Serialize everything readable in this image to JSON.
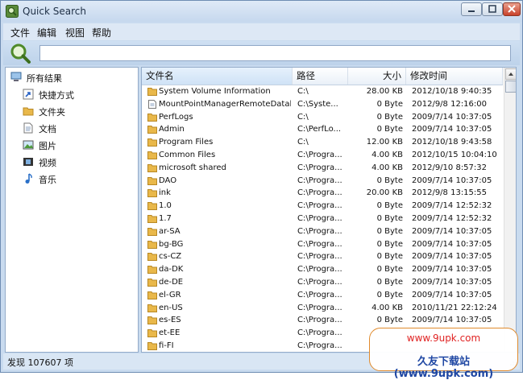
{
  "window": {
    "title": "Quick Search"
  },
  "menu": [
    "文件",
    "编辑",
    "视图",
    "帮助"
  ],
  "search": {
    "value": ""
  },
  "sidebar": {
    "root": {
      "label": "所有结果",
      "icon": "computer-icon"
    },
    "items": [
      {
        "label": "快捷方式",
        "icon": "shortcut-icon"
      },
      {
        "label": "文件夹",
        "icon": "folder-icon"
      },
      {
        "label": "文档",
        "icon": "document-icon"
      },
      {
        "label": "图片",
        "icon": "picture-icon"
      },
      {
        "label": "视频",
        "icon": "video-icon"
      },
      {
        "label": "音乐",
        "icon": "music-icon"
      }
    ]
  },
  "columns": {
    "name": "文件名",
    "path": "路径",
    "size": "大小",
    "date": "修改时间"
  },
  "rows": [
    {
      "icon": "folder",
      "name": "System Volume Information",
      "path": "C:\\",
      "size": "28.00 KB",
      "date": "2012/10/18 9:40:35"
    },
    {
      "icon": "file",
      "name": "MountPointManagerRemoteDatab...",
      "path": "C:\\Syste...",
      "size": "0 Byte",
      "date": "2012/9/8 12:16:00"
    },
    {
      "icon": "folder",
      "name": "PerfLogs",
      "path": "C:\\",
      "size": "0 Byte",
      "date": "2009/7/14 10:37:05"
    },
    {
      "icon": "folder",
      "name": "Admin",
      "path": "C:\\PerfLo...",
      "size": "0 Byte",
      "date": "2009/7/14 10:37:05"
    },
    {
      "icon": "folder",
      "name": "Program Files",
      "path": "C:\\",
      "size": "12.00 KB",
      "date": "2012/10/18 9:43:58"
    },
    {
      "icon": "folder",
      "name": "Common Files",
      "path": "C:\\Progra...",
      "size": "4.00 KB",
      "date": "2012/10/15 10:04:10"
    },
    {
      "icon": "folder",
      "name": "microsoft shared",
      "path": "C:\\Progra...",
      "size": "4.00 KB",
      "date": "2012/9/10 8:57:32"
    },
    {
      "icon": "folder",
      "name": "DAO",
      "path": "C:\\Progra...",
      "size": "0 Byte",
      "date": "2009/7/14 10:37:05"
    },
    {
      "icon": "folder",
      "name": "ink",
      "path": "C:\\Progra...",
      "size": "20.00 KB",
      "date": "2012/9/8 13:15:55"
    },
    {
      "icon": "folder",
      "name": "1.0",
      "path": "C:\\Progra...",
      "size": "0 Byte",
      "date": "2009/7/14 12:52:32"
    },
    {
      "icon": "folder",
      "name": "1.7",
      "path": "C:\\Progra...",
      "size": "0 Byte",
      "date": "2009/7/14 12:52:32"
    },
    {
      "icon": "folder",
      "name": "ar-SA",
      "path": "C:\\Progra...",
      "size": "0 Byte",
      "date": "2009/7/14 10:37:05"
    },
    {
      "icon": "folder",
      "name": "bg-BG",
      "path": "C:\\Progra...",
      "size": "0 Byte",
      "date": "2009/7/14 10:37:05"
    },
    {
      "icon": "folder",
      "name": "cs-CZ",
      "path": "C:\\Progra...",
      "size": "0 Byte",
      "date": "2009/7/14 10:37:05"
    },
    {
      "icon": "folder",
      "name": "da-DK",
      "path": "C:\\Progra...",
      "size": "0 Byte",
      "date": "2009/7/14 10:37:05"
    },
    {
      "icon": "folder",
      "name": "de-DE",
      "path": "C:\\Progra...",
      "size": "0 Byte",
      "date": "2009/7/14 10:37:05"
    },
    {
      "icon": "folder",
      "name": "el-GR",
      "path": "C:\\Progra...",
      "size": "0 Byte",
      "date": "2009/7/14 10:37:05"
    },
    {
      "icon": "folder",
      "name": "en-US",
      "path": "C:\\Progra...",
      "size": "4.00 KB",
      "date": "2010/11/21 22:12:24"
    },
    {
      "icon": "folder",
      "name": "es-ES",
      "path": "C:\\Progra...",
      "size": "0 Byte",
      "date": "2009/7/14 10:37:05"
    },
    {
      "icon": "folder",
      "name": "et-EE",
      "path": "C:\\Progra...",
      "size": "",
      "date": ""
    },
    {
      "icon": "folder",
      "name": "fi-FI",
      "path": "C:\\Progra...",
      "size": "",
      "date": ""
    }
  ],
  "status": {
    "text": "发现 107607 项"
  },
  "watermark": {
    "url": "www.9upk.com",
    "name": "久友下载站(www.9upk.com)"
  },
  "colors": {
    "folder": "#e9b84a",
    "selection": "#cfe2f6",
    "frame": "#c9dbef",
    "watermark_url": "#e02323",
    "watermark_name": "#1f47a3"
  }
}
